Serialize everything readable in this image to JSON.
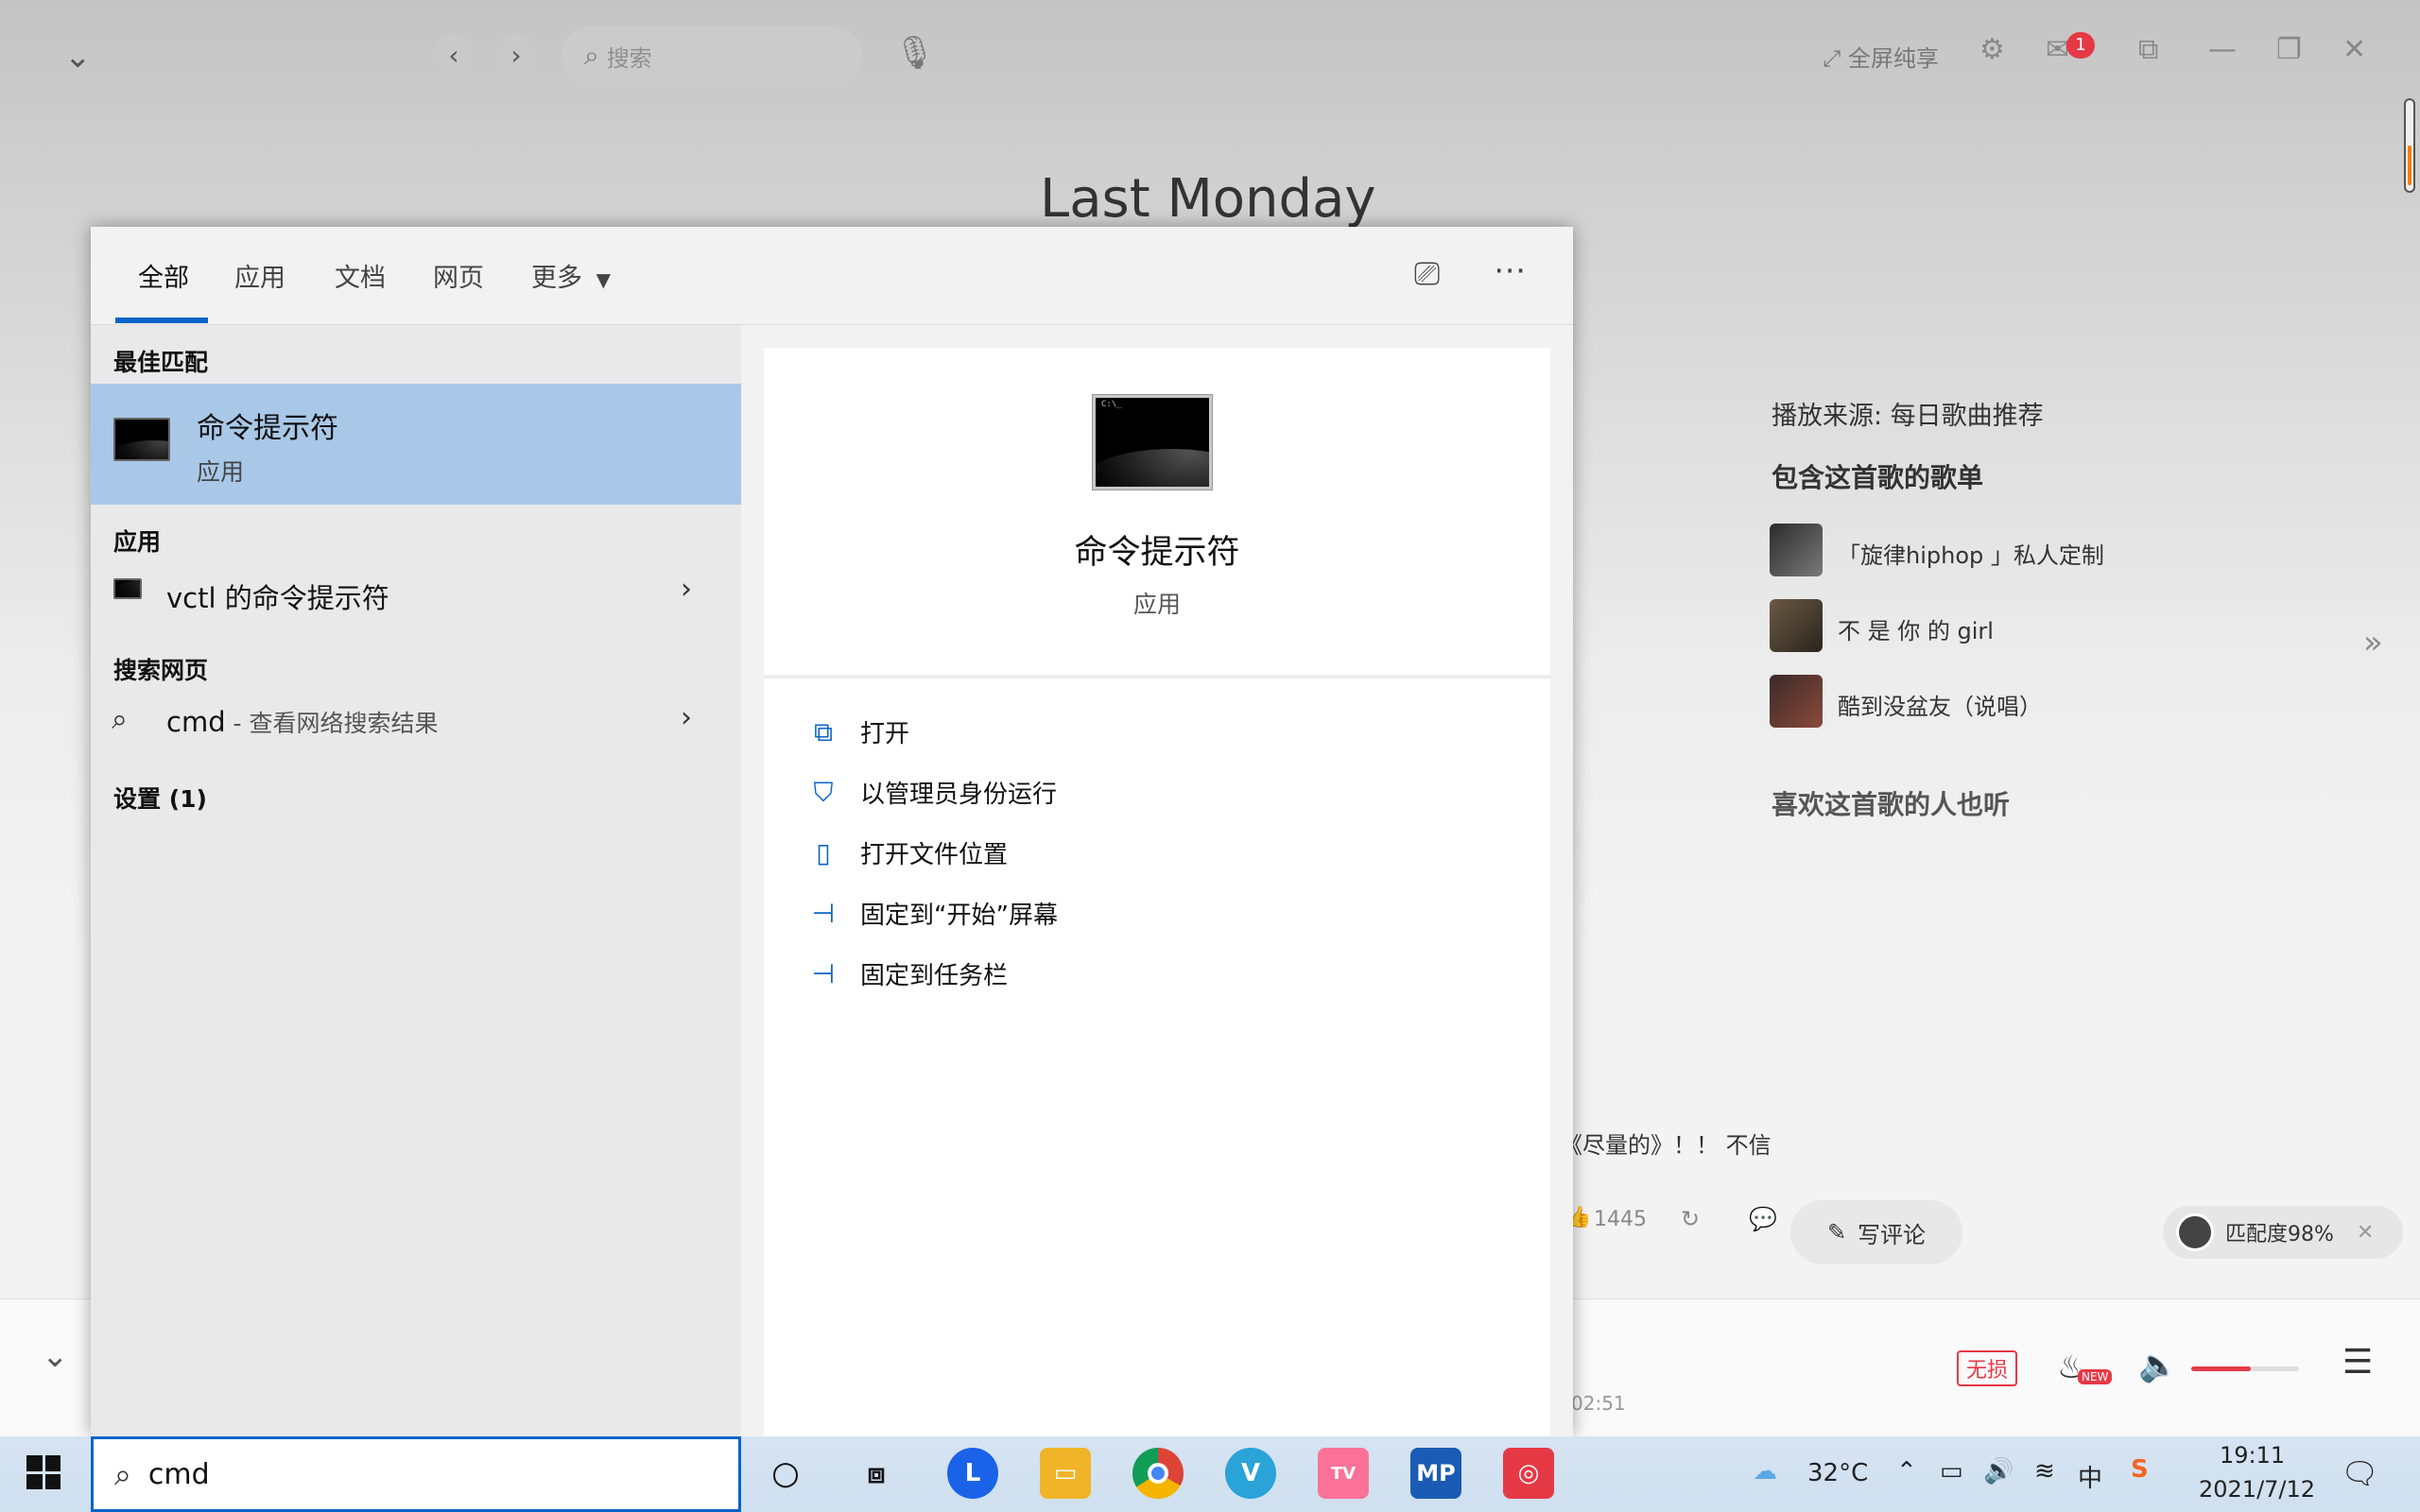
{
  "music_app": {
    "search_placeholder": "搜索",
    "fullscreen_label": "全屏纯享",
    "mail_badge": "1",
    "song_title": "Last Monday",
    "play_source": "播放来源: 每日歌曲推荐",
    "playlists_heading": "包含这首歌的歌单",
    "playlists": [
      {
        "name": "「旋律hiphop 」私人定制"
      },
      {
        "name": "不 是 你 的 girl"
      },
      {
        "name": "酷到没盆友（说唱）"
      }
    ],
    "also_liked_heading": "喜欢这首歌的人也听",
    "comment_excerpt": "《尽量的》！！ 不信",
    "like_count": "1445",
    "write_comment_label": "写评论",
    "match_label": "匹配度98%",
    "lossless_label": "无损",
    "new_badge": "NEW",
    "time_label": "02:51",
    "volume_level": 0.55
  },
  "search_panel": {
    "tabs": [
      {
        "label": "全部",
        "active": true
      },
      {
        "label": "应用"
      },
      {
        "label": "文档"
      },
      {
        "label": "网页"
      },
      {
        "label": "更多"
      }
    ],
    "best_match_heading": "最佳匹配",
    "best_match": {
      "title": "命令提示符",
      "subtitle": "应用"
    },
    "apps_heading": "应用",
    "app_result": "vctl 的命令提示符",
    "web_heading": "搜索网页",
    "web_result_query": "cmd",
    "web_result_suffix": " - 查看网络搜索结果",
    "settings_heading": "设置 (1)",
    "detail": {
      "title": "命令提示符",
      "subtitle": "应用"
    },
    "actions": [
      {
        "label": "打开",
        "icon": "open-icon"
      },
      {
        "label": "以管理员身份运行",
        "icon": "shield-icon"
      },
      {
        "label": "打开文件位置",
        "icon": "file-location-icon"
      },
      {
        "label": "固定到“开始”屏幕",
        "icon": "pin-icon"
      },
      {
        "label": "固定到任务栏",
        "icon": "pin-icon"
      }
    ]
  },
  "taskbar": {
    "search_value": "cmd",
    "weather": "32°C",
    "ime": "中",
    "time": "19:11",
    "date": "2021/7/12",
    "apps": [
      "cortana",
      "task-view",
      "lark",
      "file-explorer",
      "chrome",
      "vmware",
      "bilibili",
      "mp",
      "netease-music"
    ]
  },
  "colors": {
    "accent": "#0a64c8",
    "selection": "#a9c8e8",
    "netease_red": "#e63946"
  }
}
